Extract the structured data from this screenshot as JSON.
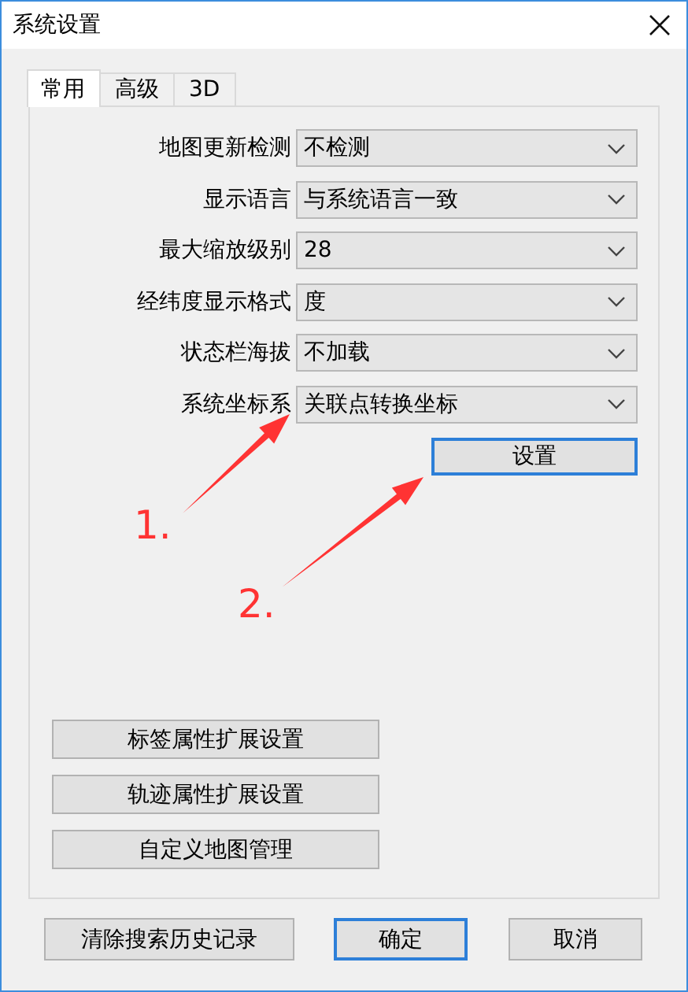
{
  "window": {
    "title": "系统设置"
  },
  "tabs": [
    {
      "label": "常用",
      "selected": true
    },
    {
      "label": "高级",
      "selected": false
    },
    {
      "label": "3D",
      "selected": false
    }
  ],
  "settings": [
    {
      "label": "地图更新检测",
      "value": "不检测"
    },
    {
      "label": "显示语言",
      "value": "与系统语言一致"
    },
    {
      "label": "最大缩放级别",
      "value": "28"
    },
    {
      "label": "经纬度显示格式",
      "value": "度"
    },
    {
      "label": "状态栏海拔",
      "value": "不加载"
    },
    {
      "label": "系统坐标系",
      "value": "关联点转换坐标"
    }
  ],
  "set_button": {
    "label": "设置",
    "focused": true
  },
  "extension_buttons": [
    "标签属性扩展设置",
    "轨迹属性扩展设置",
    "自定义地图管理"
  ],
  "footer_buttons": [
    {
      "label": "清除搜索历史记录",
      "default": false
    },
    {
      "label": "确定",
      "default": true
    },
    {
      "label": "取消",
      "default": false
    }
  ],
  "annotations": [
    {
      "label": "1."
    },
    {
      "label": "2."
    }
  ]
}
